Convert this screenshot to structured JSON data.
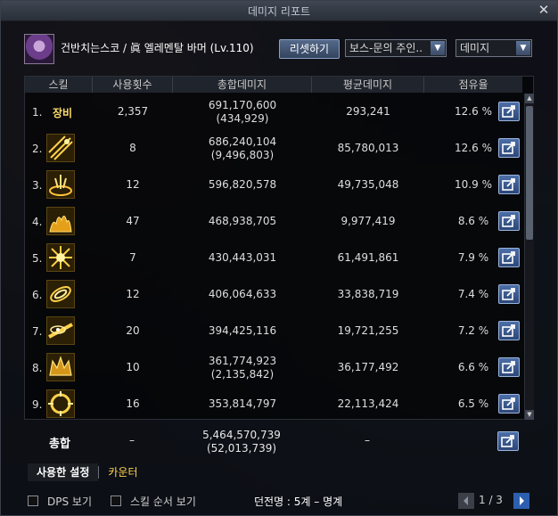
{
  "window": {
    "title": "데미지 리포트"
  },
  "header": {
    "char_name": "건반치는스코 / 眞 엘레멘탈 바머 (Lv.110)",
    "reset_label": "리셋하기",
    "boss_select": "보스-문의 주인..",
    "mode_select": "데미지"
  },
  "table": {
    "headers": {
      "skill": "스킬",
      "uses": "사용횟수",
      "total": "총합데미지",
      "avg": "평균데미지",
      "share": "점유율"
    },
    "rows": [
      {
        "idx": "1.",
        "name": "장비",
        "uses": "2,357",
        "total": "691,170,600",
        "total_sub": "(434,929)",
        "avg": "293,241",
        "share": "12.6 %",
        "icon": "equipment-text"
      },
      {
        "idx": "2.",
        "uses": "8",
        "total": "686,240,104",
        "total_sub": "(9,496,803)",
        "avg": "85,780,013",
        "share": "12.6 %",
        "icon": "lightning-streak-icon"
      },
      {
        "idx": "3.",
        "uses": "12",
        "total": "596,820,578",
        "total_sub": "",
        "avg": "49,735,048",
        "share": "10.9 %",
        "icon": "fire-pillar-icon"
      },
      {
        "idx": "4.",
        "uses": "47",
        "total": "468,938,705",
        "total_sub": "",
        "avg": "9,977,419",
        "share": "8.6 %",
        "icon": "flame-icon"
      },
      {
        "idx": "5.",
        "uses": "7",
        "total": "430,443,031",
        "total_sub": "",
        "avg": "61,491,861",
        "share": "7.9 %",
        "icon": "burst-icon"
      },
      {
        "idx": "6.",
        "uses": "12",
        "total": "406,064,633",
        "total_sub": "",
        "avg": "33,838,719",
        "share": "7.4 %",
        "icon": "vortex-icon"
      },
      {
        "idx": "7.",
        "uses": "20",
        "total": "394,425,116",
        "total_sub": "",
        "avg": "19,721,255",
        "share": "7.2 %",
        "icon": "eye-beam-icon"
      },
      {
        "idx": "8.",
        "uses": "10",
        "total": "361,774,923",
        "total_sub": "(2,135,842)",
        "avg": "36,177,492",
        "share": "6.6 %",
        "icon": "crown-icon"
      },
      {
        "idx": "9.",
        "uses": "16",
        "total": "353,814,797",
        "total_sub": "",
        "avg": "22,113,424",
        "share": "6.5 %",
        "icon": "ring-icon"
      }
    ]
  },
  "summary": {
    "label": "총합",
    "uses": "–",
    "total": "5,464,570,739",
    "total_sub": "(52,013,739)",
    "avg": "–"
  },
  "tabs": {
    "used_setting": "사용한 설정",
    "counter": "카운터"
  },
  "footer": {
    "dps_label": "DPS 보기",
    "skill_order_label": "스킬 순서 보기",
    "fight_info": "던전명 : 5계 – 명계",
    "page_indicator": "1 / 3"
  }
}
